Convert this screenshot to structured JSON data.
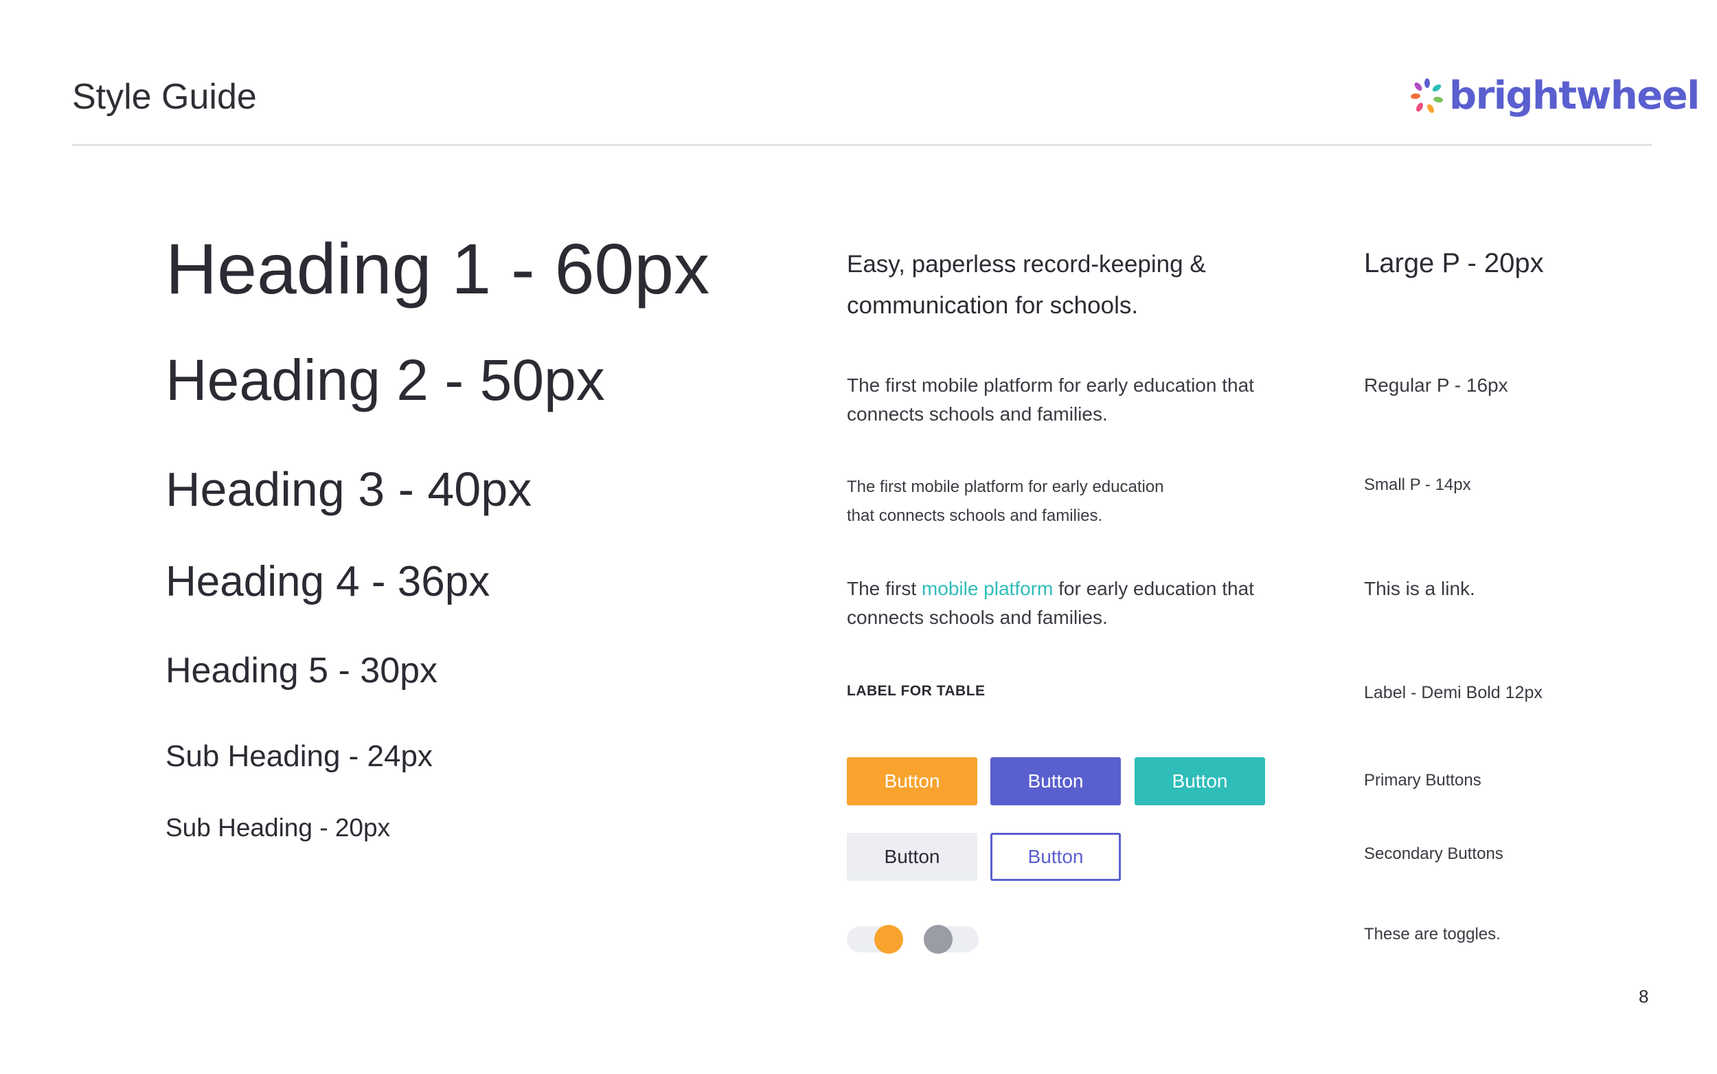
{
  "header": {
    "title": "Style Guide",
    "logo_text": "brightwheel",
    "logo_icon": "flower-burst-icon"
  },
  "headings": {
    "h1": "Heading 1 - 60px",
    "h2": "Heading 2 - 50px",
    "h3": "Heading 3 - 40px",
    "h4": "Heading 4 - 36px",
    "h5": "Heading 5 - 30px",
    "sub24": "Sub Heading - 24px",
    "sub20": "Sub Heading - 20px"
  },
  "samples": {
    "large_p": "Easy, paperless record-keeping & communication for schools.",
    "regular_p": "The first mobile platform for early education that connects schools and families.",
    "small_p_line1": "The first mobile platform for early education",
    "small_p_line2": "that connects schools and families.",
    "link_before": "The first ",
    "link_text": "mobile platform",
    "link_after": " for early education that connects schools and families.",
    "label": "LABEL FOR TABLE"
  },
  "buttons": {
    "primary": [
      "Button",
      "Button",
      "Button"
    ],
    "secondary": [
      "Button",
      "Button"
    ]
  },
  "toggles": [
    {
      "state": "on",
      "color": "#f9a32e"
    },
    {
      "state": "off",
      "color": "#9a9ca6"
    }
  ],
  "descriptions": {
    "large_p": "Large P - 20px",
    "regular_p": "Regular P - 16px",
    "small_p": "Small P - 14px",
    "link": "This is a link.",
    "label": "Label - Demi Bold 12px",
    "primary": "Primary Buttons",
    "secondary": "Secondary Buttons",
    "toggles": "These are toggles."
  },
  "colors": {
    "orange": "#f9a32e",
    "purple": "#5a5fcf",
    "teal": "#2fbdb9",
    "light_gray": "#eceef4",
    "text": "#2b2b33"
  },
  "page_number": "8"
}
